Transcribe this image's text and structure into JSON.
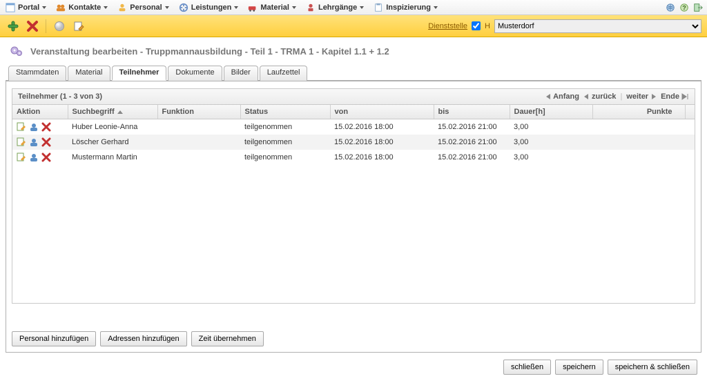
{
  "menu": {
    "items": [
      {
        "label": "Portal"
      },
      {
        "label": "Kontakte"
      },
      {
        "label": "Personal"
      },
      {
        "label": "Leistungen"
      },
      {
        "label": "Material"
      },
      {
        "label": "Lehrgänge"
      },
      {
        "label": "Inspizierung"
      }
    ]
  },
  "toolbar": {
    "dienststelle_label": "Dienststelle",
    "h_label": "H",
    "selected_dienststelle": "Musterdorf"
  },
  "page": {
    "title": "Veranstaltung bearbeiten - Truppmannausbildung - Teil 1 - TRMA 1 - Kapitel 1.1 + 1.2"
  },
  "tabs": [
    "Stammdaten",
    "Material",
    "Teilnehmer",
    "Dokumente",
    "Bilder",
    "Laufzettel"
  ],
  "active_tab": "Teilnehmer",
  "sub": {
    "header": "Teilnehmer (1 - 3 von 3)",
    "pager": {
      "anfang": "Anfang",
      "zurueck": "zurück",
      "weiter": "weiter",
      "ende": "Ende"
    }
  },
  "columns": {
    "aktion": "Aktion",
    "suchbegriff": "Suchbegriff",
    "funktion": "Funktion",
    "status": "Status",
    "von": "von",
    "bis": "bis",
    "dauer": "Dauer[h]",
    "punkte": "Punkte"
  },
  "rows": [
    {
      "name": "Huber Leonie-Anna",
      "funktion": "",
      "status": "teilgenommen",
      "von": "15.02.2016 18:00",
      "bis": "15.02.2016 21:00",
      "dauer": "3,00",
      "punkte": ""
    },
    {
      "name": "Löscher Gerhard",
      "funktion": "",
      "status": "teilgenommen",
      "von": "15.02.2016 18:00",
      "bis": "15.02.2016 21:00",
      "dauer": "3,00",
      "punkte": ""
    },
    {
      "name": "Mustermann Martin",
      "funktion": "",
      "status": "teilgenommen",
      "von": "15.02.2016 18:00",
      "bis": "15.02.2016 21:00",
      "dauer": "3,00",
      "punkte": ""
    }
  ],
  "panel_actions": {
    "personal": "Personal hinzufügen",
    "adressen": "Adressen hinzufügen",
    "zeit": "Zeit übernehmen"
  },
  "footer": {
    "close": "schließen",
    "save": "speichern",
    "save_close": "speichern & schließen"
  }
}
